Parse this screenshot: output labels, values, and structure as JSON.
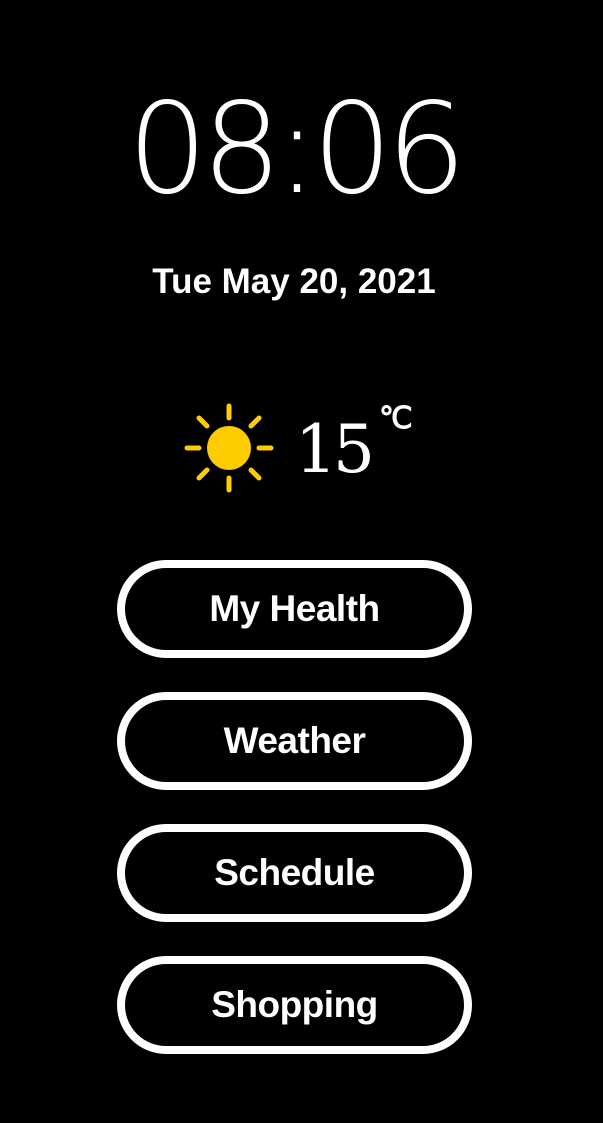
{
  "clock": {
    "time": "08:06"
  },
  "date": {
    "text": "Tue May 20, 2021"
  },
  "weather": {
    "icon": "sun-icon",
    "icon_color": "#FFCC00",
    "temperature": "15",
    "unit": "℃"
  },
  "menu": {
    "items": [
      {
        "label": "My Health"
      },
      {
        "label": "Weather"
      },
      {
        "label": "Schedule"
      },
      {
        "label": "Shopping"
      }
    ]
  },
  "colors": {
    "background": "#000000",
    "foreground": "#FFFFFF",
    "accent": "#FFCC00"
  }
}
